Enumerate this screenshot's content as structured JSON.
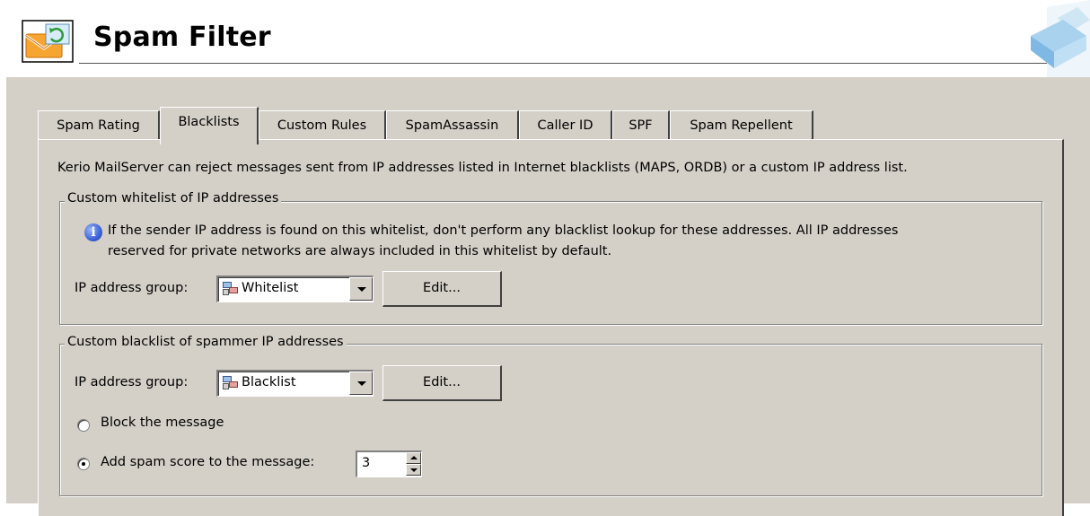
{
  "header": {
    "title": "Spam Filter",
    "icon": "mail-spam-icon",
    "logo": "kerio-corner-logo"
  },
  "tabs": [
    {
      "label": "Spam Rating",
      "active": false
    },
    {
      "label": "Blacklists",
      "active": true
    },
    {
      "label": "Custom Rules",
      "active": false
    },
    {
      "label": "SpamAssassin",
      "active": false
    },
    {
      "label": "Caller ID",
      "active": false
    },
    {
      "label": "SPF",
      "active": false
    },
    {
      "label": "Spam Repellent",
      "active": false
    }
  ],
  "intro_text": "Kerio MailServer can reject messages sent from IP addresses listed in Internet blacklists (MAPS, ORDB) or a custom IP address list.",
  "whitelist_group": {
    "title": "Custom whitelist of IP addresses",
    "info_line1": "If the sender IP address is found on this whitelist, don't perform any blacklist lookup for these addresses. All IP addresses",
    "info_line2": "reserved for private networks are always included in this whitelist by default.",
    "ip_group_label": "IP address group:",
    "ip_group_value": "Whitelist",
    "edit_label": "Edit..."
  },
  "blacklist_group": {
    "title": "Custom blacklist of spammer IP addresses",
    "ip_group_label": "IP address group:",
    "ip_group_value": "Blacklist",
    "edit_label": "Edit...",
    "block_label": "Block the message",
    "add_score_label": "Add spam score to the message:",
    "selected_action": "add_score",
    "spam_score": "3"
  },
  "colors": {
    "dialog_bg": "#d4d0c8",
    "info_blue": "#3a63d8"
  }
}
